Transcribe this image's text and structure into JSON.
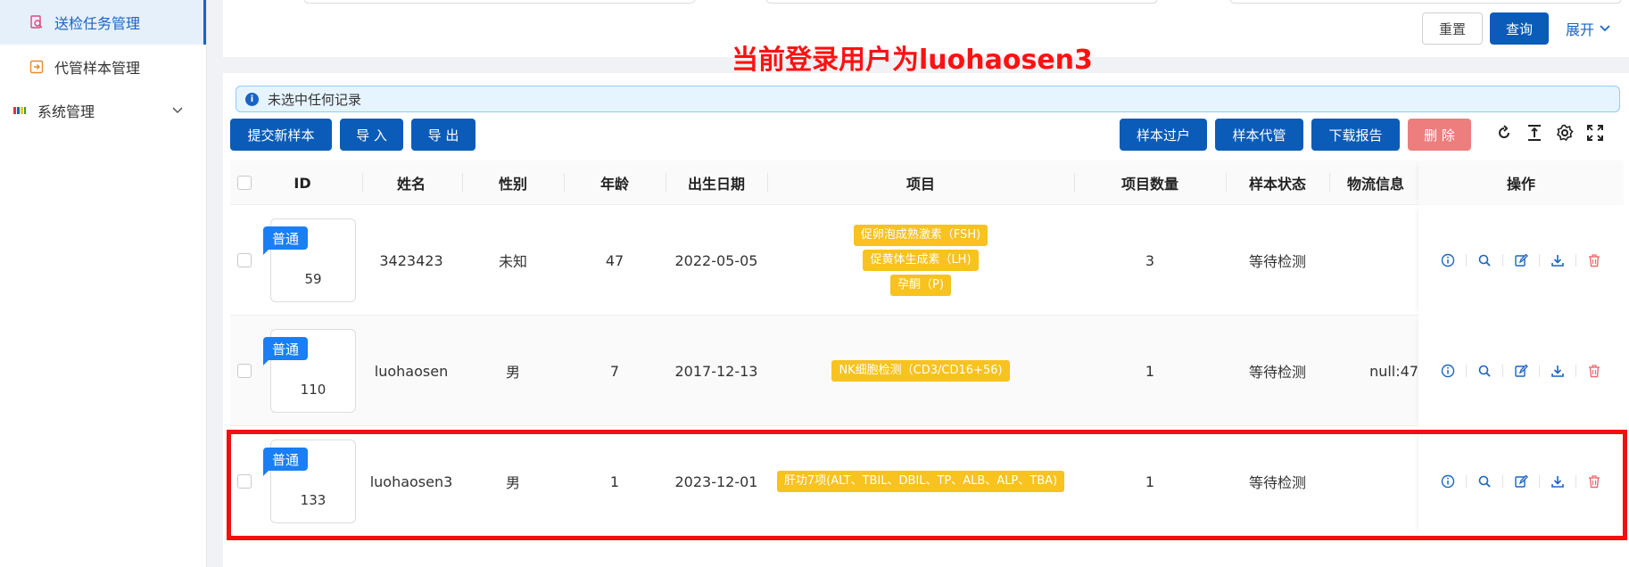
{
  "sidebar": {
    "items": [
      {
        "label": "送检任务管理",
        "icon": "search-document-icon",
        "active": true
      },
      {
        "label": "代管样本管理",
        "icon": "import-box-icon",
        "active": false
      },
      {
        "label": "系统管理",
        "icon": "system-grid-icon",
        "active": false
      }
    ]
  },
  "filters": {
    "reset_label": "重置",
    "query_label": "查询",
    "expand_label": "展开"
  },
  "banner": "当前登录用户为luohaosen3",
  "alert": {
    "text": "未选中任何记录"
  },
  "toolbar": {
    "submit_label": "提交新样本",
    "import_label": "导 入",
    "export_label": "导 出",
    "transfer_label": "样本过户",
    "custody_label": "样本代管",
    "download_label": "下载报告",
    "delete_label": "删 除"
  },
  "table": {
    "columns": [
      "ID",
      "姓名",
      "性别",
      "年龄",
      "出生日期",
      "项目",
      "项目数量",
      "样本状态",
      "物流信息",
      "操作"
    ],
    "rows": [
      {
        "badge": "普通",
        "id": "59",
        "name": "3423423",
        "gender": "未知",
        "age": "47",
        "birth": "2022-05-05",
        "items": [
          "促卵泡成熟激素（FSH)",
          "促黄体生成素（LH)",
          "孕酮（P)"
        ],
        "count": "3",
        "status": "等待检测",
        "logistics": ""
      },
      {
        "badge": "普通",
        "id": "110",
        "name": "luohaosen",
        "gender": "男",
        "age": "7",
        "birth": "2017-12-13",
        "items": [
          "NK细胞检测（CD3/CD16+56)"
        ],
        "count": "1",
        "status": "等待检测",
        "logistics": "null:47"
      },
      {
        "badge": "普通",
        "id": "133",
        "name": "luohaosen3",
        "gender": "男",
        "age": "1",
        "birth": "2023-12-01",
        "items": [
          "肝功7项(ALT、TBIL、DBIL、TP、ALB、ALP、TBA)"
        ],
        "count": "1",
        "status": "等待检测",
        "logistics": ""
      }
    ]
  },
  "colors": {
    "primary": "#0b5cb8",
    "danger": "#ee7d7d",
    "tag": "#f8c21f",
    "badge": "#1a7ef5",
    "banner": "#ff1111"
  }
}
